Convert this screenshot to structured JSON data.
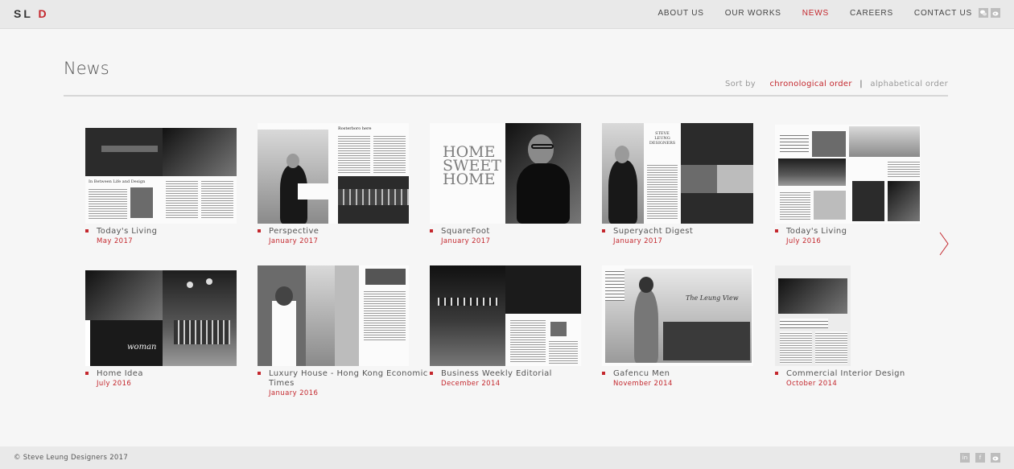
{
  "header": {
    "logo": {
      "letters": "SL",
      "accent": "D"
    },
    "nav": [
      "ABOUT US",
      "OUR WORKS",
      "NEWS",
      "CAREERS",
      "CONTACT US"
    ],
    "active_nav": "NEWS",
    "icons": [
      "wechat-icon",
      "weibo-icon"
    ]
  },
  "page": {
    "title": "News",
    "sort_label": "Sort by",
    "sort_options": [
      "chronological order",
      "alphabetical order"
    ],
    "active_sort": "chronological order"
  },
  "articles": [
    {
      "title": "Today's Living",
      "date": "May 2017"
    },
    {
      "title": "Perspective",
      "date": "January 2017"
    },
    {
      "title": "SquareFoot",
      "date": "January 2017"
    },
    {
      "title": "Superyacht Digest",
      "date": "January 2017"
    },
    {
      "title": "Today's Living",
      "date": "July 2016"
    },
    {
      "title": "Home Idea",
      "date": "July 2016"
    },
    {
      "title": "Luxury House - Hong Kong Economic Times",
      "date": "January 2016"
    },
    {
      "title": "Business Weekly Editorial",
      "date": "December 2014"
    },
    {
      "title": "Gafencu Men",
      "date": "November 2014"
    },
    {
      "title": "Commercial Interior Design",
      "date": "October 2014"
    }
  ],
  "thumb_text": {
    "living_heading": "In Between Life and Design",
    "home_sweet_home": "HOME SWEET HOME",
    "perspective_heading": "Rosterboro here",
    "steve_leung": "STEVE LEUNG DESIGNERS",
    "woman": "woman",
    "leung_view": "The Leung View"
  },
  "footer": {
    "copyright": "© Steve Leung Designers 2017",
    "icons": [
      "linkedin-icon",
      "facebook-icon",
      "weibo-icon"
    ]
  },
  "colors": {
    "accent": "#c4272d",
    "header_bg": "#e9e9e9",
    "page_bg": "#f6f6f6"
  }
}
